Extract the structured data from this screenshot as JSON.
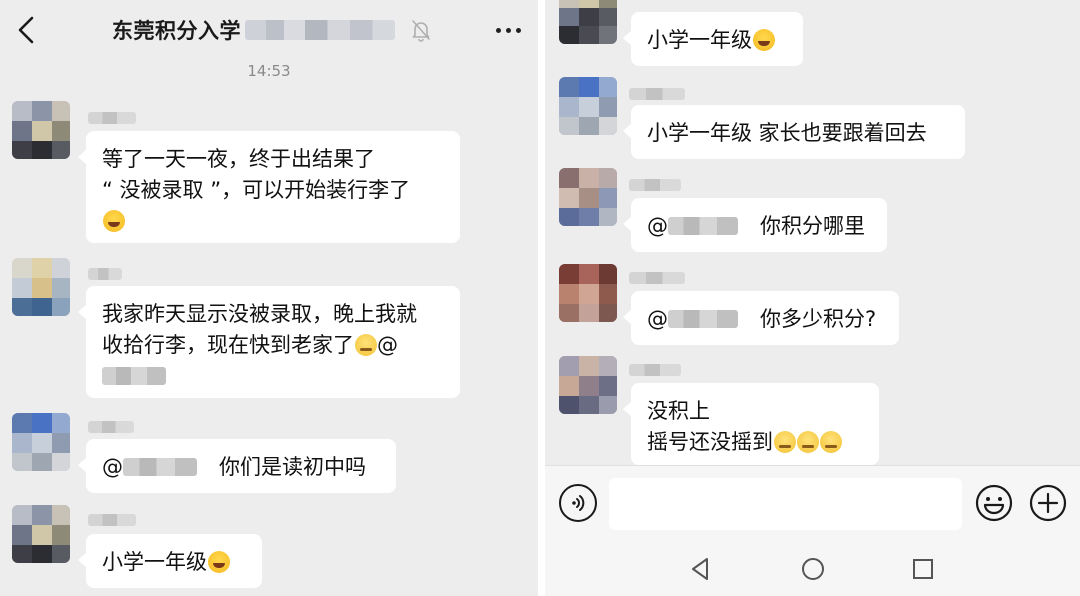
{
  "header": {
    "title": "东莞积分入学",
    "back_icon": "chevron-left-icon",
    "mute_icon": "bell-off-icon",
    "more_icon": "more-dots-icon"
  },
  "timestamp": "14:53",
  "left_messages": [
    {
      "lines": [
        "等了一天一夜，终于出结果了",
        "“ 没被录取 ”，可以开始装行李了"
      ],
      "emoji": "😂"
    },
    {
      "lines": [
        "我家昨天显示没被录取，晚上我就",
        "收拾行李，现在快到老家了"
      ],
      "emoji": "😭",
      "mention": "@"
    },
    {
      "mention": "@",
      "text": "你们是读初中吗"
    },
    {
      "text": "小学一年级",
      "emoji": "😂"
    }
  ],
  "right_messages": [
    {
      "text": "小学一年级",
      "emoji": "😂"
    },
    {
      "text": "小学一年级 家长也要跟着回去"
    },
    {
      "mention": "@",
      "text": "你积分哪里"
    },
    {
      "mention": "@",
      "text": "你多少积分?"
    },
    {
      "lines": [
        "没积上",
        "摇号还没摇到"
      ],
      "emoji": "🥲🥲🥲"
    }
  ],
  "input": {
    "voice_icon": "voice-icon",
    "value": "",
    "emoji_icon": "smile-icon",
    "plus_icon": "plus-icon"
  },
  "nav": {
    "back_icon": "nav-back-icon",
    "home_icon": "nav-home-icon",
    "recent_icon": "nav-recent-icon"
  }
}
